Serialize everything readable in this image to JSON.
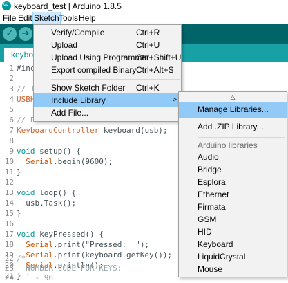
{
  "window": {
    "title": "keyboard_test | Arduino 1.8.5"
  },
  "menubar": {
    "file": "File",
    "edit": "Edit",
    "sketch": "Sketch",
    "tools": "Tools",
    "help": "Help"
  },
  "toolbar": {
    "verify_glyph": "✓",
    "upload_glyph": "➔"
  },
  "tab": {
    "label": "keyboa"
  },
  "code": [
    {
      "n": "1",
      "a": "#inc",
      "b": ""
    },
    {
      "n": "2",
      "a": "",
      "b": ""
    },
    {
      "n": "3",
      "a": "// I",
      "b": ""
    },
    {
      "n": "4",
      "a": "USBH",
      "b": ""
    },
    {
      "n": "5",
      "a": "",
      "b": ""
    },
    {
      "n": "6",
      "a": "// P",
      "b": ""
    },
    {
      "n": "7",
      "a": "KeyboardController",
      "b": " keyboard(usb);"
    },
    {
      "n": "8",
      "a": "",
      "b": ""
    },
    {
      "n": "9",
      "a": "void",
      "b": " setup() {"
    },
    {
      "n": "10",
      "a": "  Serial",
      "b": ".begin(9600);"
    },
    {
      "n": "11",
      "a": "}",
      "b": ""
    },
    {
      "n": "12",
      "a": "",
      "b": ""
    },
    {
      "n": "13",
      "a": "void",
      "b": " loop() {"
    },
    {
      "n": "14",
      "a": "  usb.",
      "b": "Task();"
    },
    {
      "n": "15",
      "a": "}",
      "b": ""
    },
    {
      "n": "16",
      "a": "",
      "b": ""
    },
    {
      "n": "17",
      "a": "void",
      "b": " keyPressed() {"
    },
    {
      "n": "18",
      "a": "  Serial",
      "b": ".print(\"Pressed:  \");"
    },
    {
      "n": "19",
      "a": "  Serial",
      "b": ".print(keyboard.getKey());"
    },
    {
      "n": "20",
      "a": "  Serial",
      "b": ".println();"
    },
    {
      "n": "21",
      "a": "}",
      "b": ""
    },
    {
      "n": "22",
      "a": "/*",
      "b": ""
    },
    {
      "n": "23",
      "a": "  NUMBER CODE FOR KEYS:",
      "b": ""
    },
    {
      "n": "24",
      "a": "  ` - 96",
      "b": ""
    }
  ],
  "sketch_menu": {
    "verify": {
      "label": "Verify/Compile",
      "shortcut": "Ctrl+R"
    },
    "upload": {
      "label": "Upload",
      "shortcut": "Ctrl+U"
    },
    "upload_programmer": {
      "label": "Upload Using Programmer",
      "shortcut": "Ctrl+Shift+U"
    },
    "export_binary": {
      "label": "Export compiled Binary",
      "shortcut": "Ctrl+Alt+S"
    },
    "show_folder": {
      "label": "Show Sketch Folder",
      "shortcut": "Ctrl+K"
    },
    "include_library": {
      "label": "Include Library",
      "arrow": ">"
    },
    "add_file": {
      "label": "Add File..."
    }
  },
  "library_submenu": {
    "scroll_up": "△",
    "manage": "Manage Libraries...",
    "add_zip": "Add .ZIP Library...",
    "header": "Arduino libraries",
    "libraries": [
      "Audio",
      "Bridge",
      "Esplora",
      "Ethernet",
      "Firmata",
      "GSM",
      "HID",
      "Keyboard",
      "LiquidCrystal",
      "Mouse"
    ]
  }
}
